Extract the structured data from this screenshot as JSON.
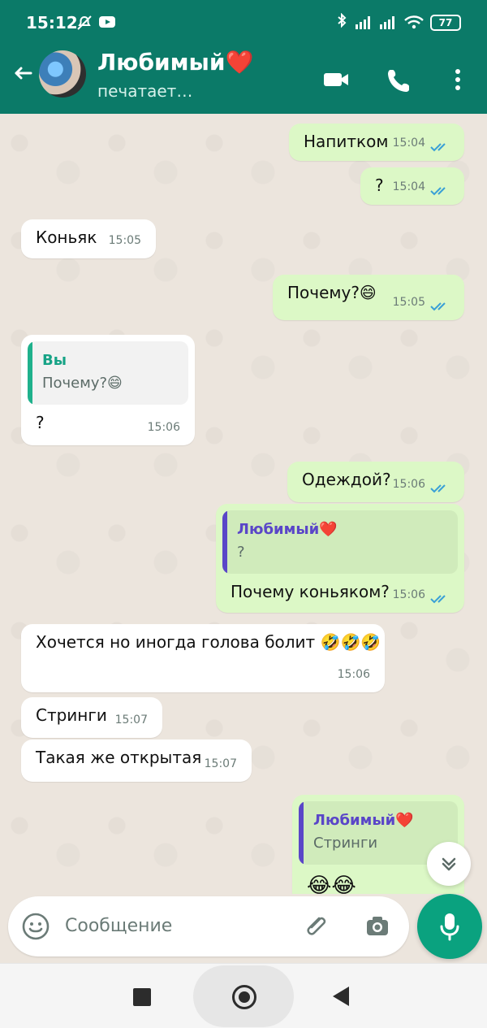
{
  "status_bar": {
    "time": "15:12",
    "battery": "77"
  },
  "header": {
    "contact_name": "Любимый❤️",
    "status": "печатает…"
  },
  "messages": [
    {
      "dir": "out",
      "text": "Напитком",
      "time": "15:04"
    },
    {
      "dir": "out",
      "text": "?",
      "time": "15:04"
    },
    {
      "dir": "in",
      "text": "Коньяк",
      "time": "15:05"
    },
    {
      "dir": "out",
      "text": "Почему?😄",
      "time": "15:05"
    },
    {
      "dir": "in",
      "quote": {
        "name": "Вы",
        "text": "Почему?😄"
      },
      "text": "?",
      "time": "15:06"
    },
    {
      "dir": "out",
      "text": "Одеждой?",
      "time": "15:06"
    },
    {
      "dir": "out",
      "quote": {
        "name": "Любимый❤️",
        "text": "?"
      },
      "text": "Почему коньяком?",
      "time": "15:06"
    },
    {
      "dir": "in",
      "text": "Хочется но иногда голова болит 🤣🤣🤣",
      "time": "15:06"
    },
    {
      "dir": "in",
      "text": "Стринги",
      "time": "15:07"
    },
    {
      "dir": "in",
      "text": "Такая же открытая",
      "time": "15:07"
    },
    {
      "dir": "out",
      "quote": {
        "name": "Любимый❤️",
        "text": "Стринги"
      },
      "text": "😂😂"
    }
  ],
  "composer": {
    "placeholder": "Сообщение"
  },
  "colors": {
    "header": "#0b7a68",
    "outgoing_bubble": "#dcf8c6",
    "incoming_bubble": "#ffffff",
    "mic_button": "#0aa27f",
    "read_ticks": "#3aa0d6"
  },
  "icons": [
    "back-arrow-icon",
    "video-call-icon",
    "phone-call-icon",
    "more-options-icon",
    "scroll-down-icon",
    "emoji-icon",
    "attach-icon",
    "camera-icon",
    "mic-icon",
    "nav-recents-icon",
    "nav-home-icon",
    "nav-back-icon"
  ]
}
